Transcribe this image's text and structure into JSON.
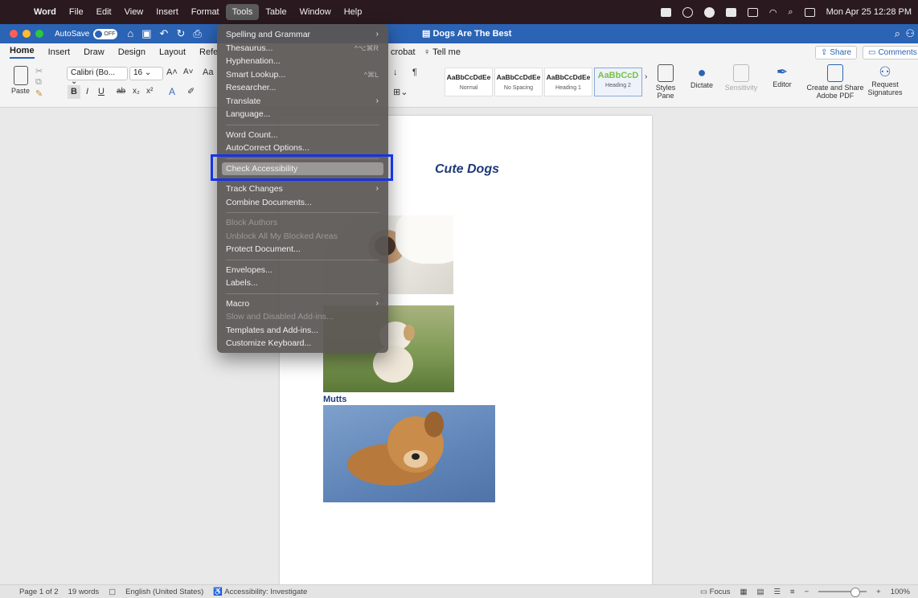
{
  "menubar": {
    "app": "Word",
    "items": [
      "File",
      "Edit",
      "View",
      "Insert",
      "Format",
      "Tools",
      "Table",
      "Window",
      "Help"
    ],
    "active": "Tools",
    "clock": "Mon Apr 25  12:28 PM"
  },
  "titlebar": {
    "autosave_label": "AutoSave",
    "autosave_state": "OFF",
    "doc_title": "Dogs Are The Best",
    "traffic_colors": [
      "#ff5f57",
      "#febc2e",
      "#28c840"
    ]
  },
  "ribbon": {
    "tabs": [
      "Home",
      "Insert",
      "Draw",
      "Design",
      "Layout",
      "Refe"
    ],
    "tab_acrobat": "crobat",
    "tell_me": "Tell me",
    "share": "Share",
    "comments": "Comments",
    "paste": "Paste",
    "font_name": "Calibri (Bo...",
    "font_size": "16",
    "styles": [
      {
        "preview": "AaBbCcDdEe",
        "name": "Normal"
      },
      {
        "preview": "AaBbCcDdEe",
        "name": "No Spacing"
      },
      {
        "preview": "AaBbCcDdEe",
        "name": "Heading 1"
      },
      {
        "preview": "AaBbCcD",
        "name": "Heading 2"
      }
    ],
    "styles_pane": "Styles Pane",
    "dictate": "Dictate",
    "sensitivity": "Sensitivity",
    "editor": "Editor",
    "create_share": "Create and Share Adobe PDF",
    "request_sig": "Request Signatures"
  },
  "tools_menu": {
    "groups": [
      [
        {
          "label": "Spelling and Grammar",
          "submenu": true
        },
        {
          "label": "Thesaurus...",
          "shortcut": "^⌥⌘R"
        },
        {
          "label": "Hyphenation..."
        },
        {
          "label": "Smart Lookup...",
          "shortcut": "^⌘L"
        },
        {
          "label": "Researcher..."
        },
        {
          "label": "Translate",
          "submenu": true
        },
        {
          "label": "Language..."
        }
      ],
      [
        {
          "label": "Word Count..."
        },
        {
          "label": "AutoCorrect Options..."
        }
      ],
      [
        {
          "label": "Check Accessibility",
          "highlighted": true
        }
      ],
      [
        {
          "label": "Track Changes",
          "submenu": true
        },
        {
          "label": "Combine Documents..."
        }
      ],
      [
        {
          "label": "Block Authors",
          "disabled": true
        },
        {
          "label": "Unblock All My Blocked Areas",
          "disabled": true
        },
        {
          "label": "Protect Document..."
        }
      ],
      [
        {
          "label": "Envelopes..."
        },
        {
          "label": "Labels..."
        }
      ],
      [
        {
          "label": "Macro",
          "submenu": true
        },
        {
          "label": "Slow and Disabled Add-ins...",
          "disabled": true
        },
        {
          "label": "Templates and Add-ins..."
        },
        {
          "label": "Customize Keyboard..."
        }
      ]
    ]
  },
  "document": {
    "heading": "Cute Dogs",
    "caption_partial": "s",
    "caption_mutts": "Mutts"
  },
  "status": {
    "page": "Page 1 of 2",
    "words": "19 words",
    "language": "English (United States)",
    "accessibility": "Accessibility: Investigate",
    "focus": "Focus",
    "zoom": "100%"
  }
}
